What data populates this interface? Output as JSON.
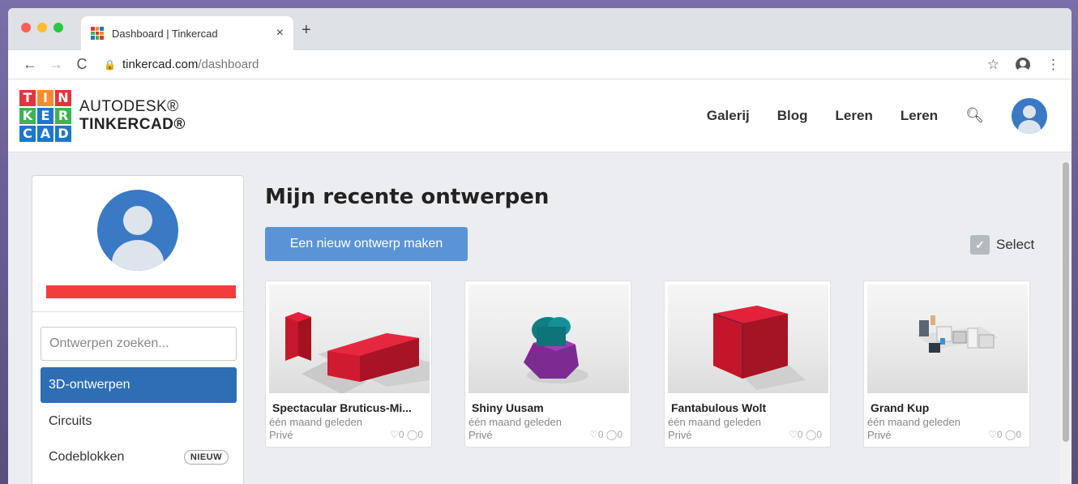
{
  "browser": {
    "tab_title": "Dashboard | Tinkercad",
    "tab_close": "×",
    "new_tab": "+",
    "url_domain": "tinkercad.com",
    "url_path": "/dashboard"
  },
  "header": {
    "logo_letters": [
      "T",
      "I",
      "N",
      "K",
      "E",
      "R",
      "C",
      "A",
      "D"
    ],
    "brand_top": "AUTODESK®",
    "brand_bottom": "TINKERCAD®",
    "nav": [
      "Galerij",
      "Blog",
      "Leren",
      "Leren"
    ]
  },
  "sidebar": {
    "search_placeholder": "Ontwerpen zoeken...",
    "items": [
      {
        "label": "3D-ontwerpen",
        "active": true
      },
      {
        "label": "Circuits"
      },
      {
        "label": "Codeblokken",
        "badge": "NIEUW"
      }
    ]
  },
  "main": {
    "title": "Mijn recente ontwerpen",
    "new_design_label": "Een nieuw ontwerp maken",
    "select_label": "Select"
  },
  "designs": [
    {
      "title": "Spectacular Bruticus-Mi...",
      "date": "één maand geleden",
      "privacy": "Privé",
      "stats": "♡0 ◯0"
    },
    {
      "title": "Shiny Uusam",
      "date": "één maand geleden",
      "privacy": "Privé",
      "stats": "♡0 ◯0"
    },
    {
      "title": "Fantabulous Wolt",
      "date": "één maand geleden",
      "privacy": "Privé",
      "stats": "♡0 ◯0"
    },
    {
      "title": "Grand Kup",
      "date": "één maand geleden",
      "privacy": "Privé",
      "stats": "♡0 ◯0"
    }
  ],
  "colors": {
    "accent_blue": "#2d6eb5",
    "button_blue": "#5b94d6",
    "name_bar_red": "#f23c3c"
  }
}
